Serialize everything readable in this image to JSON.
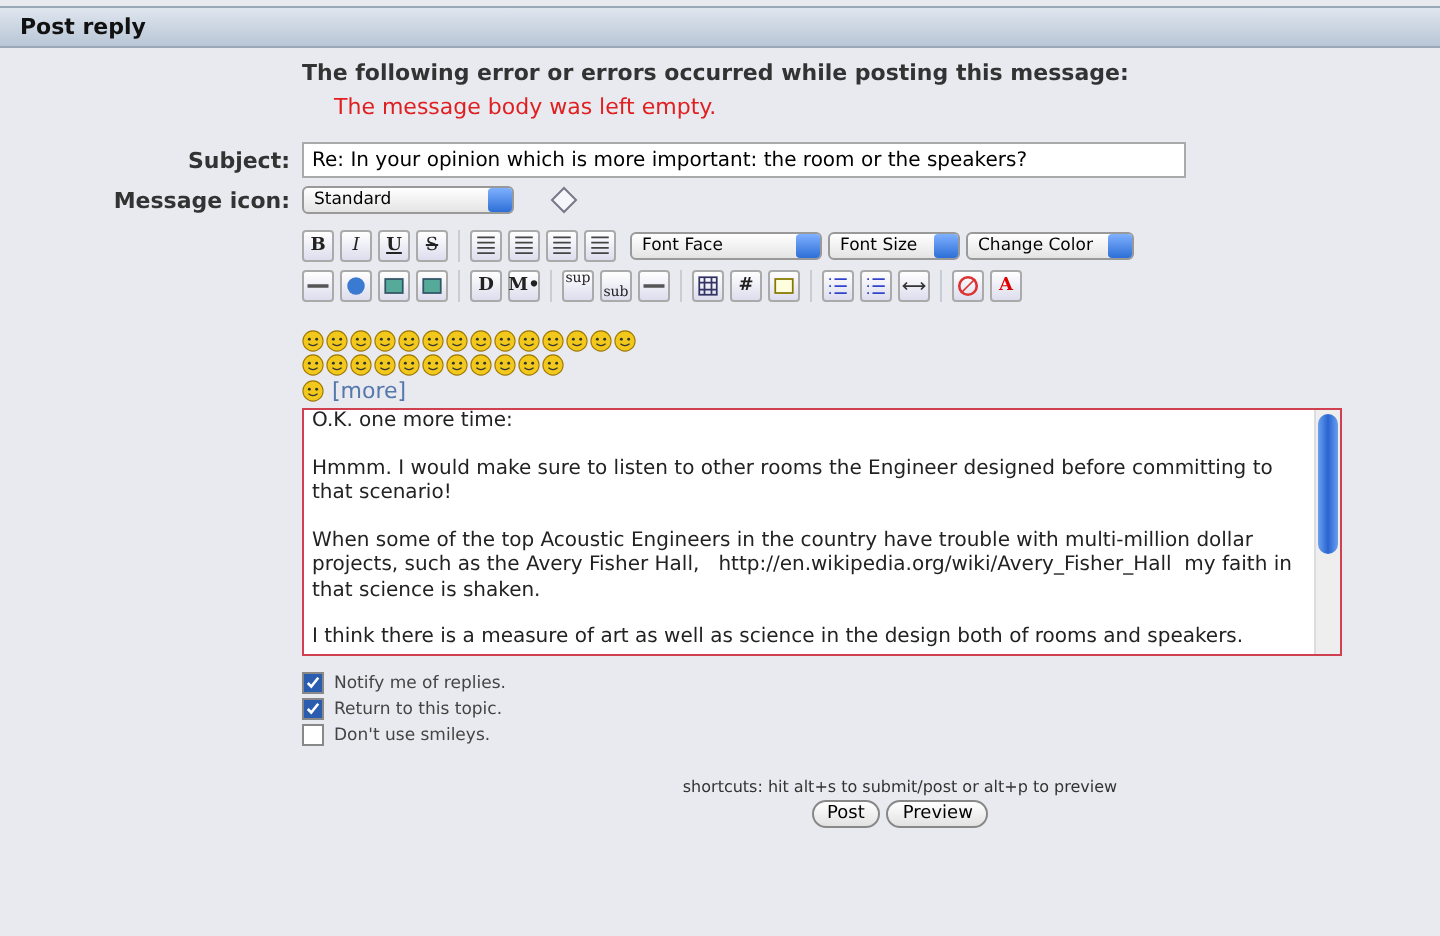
{
  "panel": {
    "title": "Post reply"
  },
  "errors": {
    "heading": "The following error or errors occurred while posting this message:",
    "messages": [
      "The message body was left empty."
    ]
  },
  "subject": {
    "label": "Subject:",
    "value": "Re: In your opinion which is more important: the room or the speakers?"
  },
  "message_icon": {
    "label": "Message icon:",
    "value": "Standard"
  },
  "toolbar_row_1": [
    {
      "kind": "text",
      "label": "B"
    },
    {
      "kind": "text",
      "label": "I"
    },
    {
      "kind": "text",
      "label": "U"
    },
    {
      "kind": "text",
      "label": "S"
    },
    {
      "kind": "sep"
    },
    {
      "kind": "icon"
    },
    {
      "kind": "icon"
    },
    {
      "kind": "icon"
    },
    {
      "kind": "icon"
    }
  ],
  "selects": [
    "Font Face",
    "Font Size",
    "Change Color"
  ],
  "toolbar_row_2": [
    {
      "kind": "icon"
    },
    {
      "kind": "icon"
    },
    {
      "kind": "icon"
    },
    {
      "kind": "icon"
    },
    {
      "kind": "sep"
    },
    {
      "kind": "text",
      "label": "D"
    },
    {
      "kind": "text",
      "label": "M•"
    },
    {
      "kind": "sep"
    },
    {
      "kind": "text",
      "label": "sup"
    },
    {
      "kind": "text",
      "label": "sub"
    },
    {
      "kind": "icon"
    },
    {
      "kind": "sep"
    },
    {
      "kind": "icon"
    },
    {
      "kind": "text",
      "label": "#"
    },
    {
      "kind": "icon"
    },
    {
      "kind": "sep"
    },
    {
      "kind": "icon"
    },
    {
      "kind": "icon"
    },
    {
      "kind": "icon"
    },
    {
      "kind": "sep"
    },
    {
      "kind": "icon"
    },
    {
      "kind": "text",
      "label": "A"
    }
  ],
  "more_link": "[more]",
  "message": [
    "O.K. one more time:",
    "Hmmm. I would make sure to listen to other rooms the Engineer designed before committing to that scenario!",
    "When some of the top Acoustic Engineers in the country have trouble with multi-million dollar projects, such as the Avery Fisher Hall,   http://en.wikipedia.org/wiki/Avery_Fisher_Hall  my faith in that science is shaken.",
    "I think there is a measure of art as well as science in the design both of rooms and speakers."
  ],
  "options": [
    {
      "label": "Notify me of replies.",
      "checked": true
    },
    {
      "label": "Return to this topic.",
      "checked": true
    },
    {
      "label": "Don't use smileys.",
      "checked": false
    }
  ],
  "shortcuts": "shortcuts: hit alt+s to submit/post or alt+p to preview",
  "buttons": [
    "Post",
    "Preview"
  ]
}
